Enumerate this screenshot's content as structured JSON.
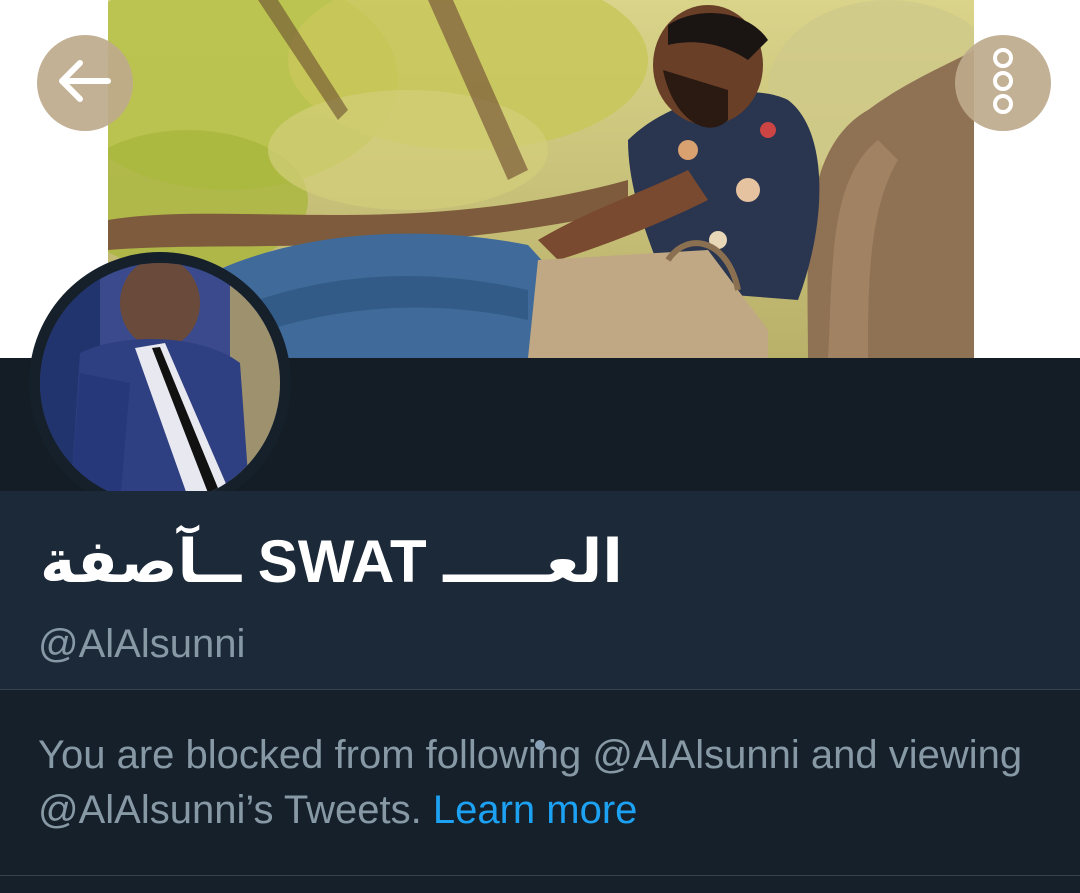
{
  "profile": {
    "display_name": "العـــــ SWAT ــآصفة",
    "handle": "@AlAlsunni"
  },
  "blocked_notice": {
    "message": "You are blocked from following @AlAlsunni and viewing @AlAlsunni’s Tweets.",
    "learn_more_label": "Learn more"
  },
  "icons": {
    "back": "arrow-left-icon",
    "more": "more-vertical-icon"
  },
  "colors": {
    "background": "#15202b",
    "info_panel": "#1c2938",
    "text_secondary": "#8899a6",
    "link": "#1da1f2",
    "nav_button": "#beaa8c"
  }
}
